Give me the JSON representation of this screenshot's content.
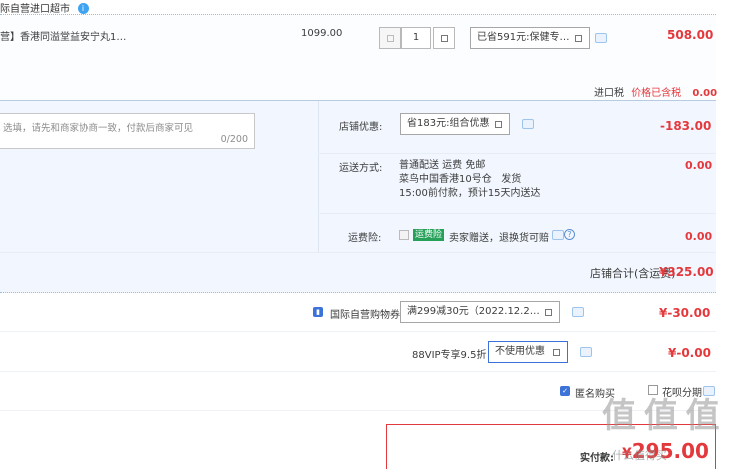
{
  "shop": {
    "name_partial": "际自营进口超市",
    "badge": "i"
  },
  "item": {
    "title_partial": "营】香港同溢堂益安宁丸1…",
    "unit_price": "1099.00",
    "quantity": "1",
    "promo_select": "已省591元:保健专…",
    "subtotal": "508.00"
  },
  "tax": {
    "label": "进口税",
    "note": "价格已含税",
    "value": "0.00"
  },
  "message": {
    "placeholder": "选填，请先和商家协商一致，付款后商家可见",
    "counter": "0/200"
  },
  "shop_discount": {
    "label": "店铺优惠:",
    "select": "省183元:组合优惠",
    "value": "-183.00"
  },
  "shipping": {
    "label": "运送方式:",
    "method": "普通配送 运费 免邮",
    "origin": "菜鸟中国香港10号仓   发货",
    "eta": "15:00前付款，预计15天内送达",
    "value": "0.00"
  },
  "insurance": {
    "label": "运费险:",
    "badge": "运费险",
    "text": "卖家赠送，退换货可赔",
    "help": "?",
    "value": "0.00"
  },
  "shop_total": {
    "label": "店铺合计(含运费)",
    "value": "¥325.00"
  },
  "coupon": {
    "label": "国际自营购物券",
    "select": "满299减30元（2022.12.2…",
    "value": "¥-30.00"
  },
  "vip": {
    "label": "88VIP专享9.5折",
    "select": "不使用优惠",
    "value": "¥-0.00"
  },
  "options": {
    "anonymous": "匿名购买",
    "installment": "花呗分期"
  },
  "pay": {
    "label": "实付款:",
    "value": "295.00"
  },
  "watermark": {
    "main": "值 值 值",
    "sub": "什么值得买"
  },
  "colors": {
    "accent_red": "#e4393c",
    "panel_bg": "#f2f7ff",
    "border_blue": "#b8cbe0"
  }
}
